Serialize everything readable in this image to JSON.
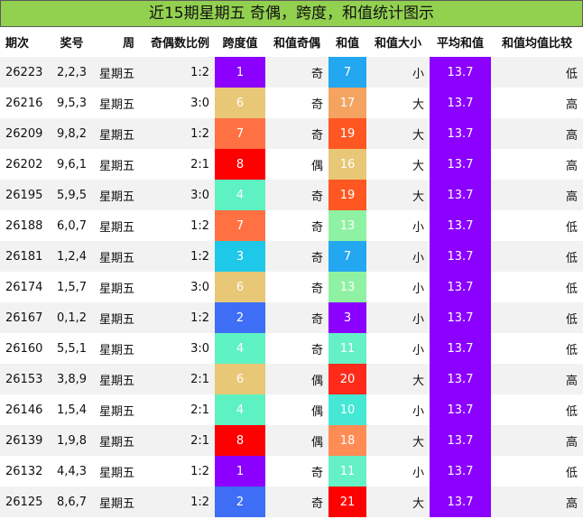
{
  "title": "近15期星期五 奇偶，跨度，和值统计图示",
  "headers": [
    "期次",
    "奖号",
    "周",
    "奇偶数比例",
    "跨度值",
    "和值奇偶",
    "和值",
    "和值大小",
    "平均和值",
    "和值均值比较"
  ],
  "rows": [
    {
      "issue": "26223",
      "nums": "2,2,3",
      "week": "星期五",
      "ratio": "1:2",
      "span": "1",
      "span_color": "#8b00ff",
      "parity": "奇",
      "sum": "7",
      "sum_color": "#22a7f0",
      "size": "小",
      "avg": "13.7",
      "cmp": "低"
    },
    {
      "issue": "26216",
      "nums": "9,5,3",
      "week": "星期五",
      "ratio": "3:0",
      "span": "6",
      "span_color": "#e8c777",
      "parity": "奇",
      "sum": "17",
      "sum_color": "#f4a460",
      "size": "大",
      "avg": "13.7",
      "cmp": "高"
    },
    {
      "issue": "26209",
      "nums": "9,8,2",
      "week": "星期五",
      "ratio": "1:2",
      "span": "7",
      "span_color": "#ff7043",
      "parity": "奇",
      "sum": "19",
      "sum_color": "#ff5722",
      "size": "大",
      "avg": "13.7",
      "cmp": "高"
    },
    {
      "issue": "26202",
      "nums": "9,6,1",
      "week": "星期五",
      "ratio": "2:1",
      "span": "8",
      "span_color": "#ff0000",
      "parity": "偶",
      "sum": "16",
      "sum_color": "#e8c777",
      "size": "大",
      "avg": "13.7",
      "cmp": "高"
    },
    {
      "issue": "26195",
      "nums": "5,9,5",
      "week": "星期五",
      "ratio": "3:0",
      "span": "4",
      "span_color": "#5ef2c2",
      "parity": "奇",
      "sum": "19",
      "sum_color": "#ff5722",
      "size": "大",
      "avg": "13.7",
      "cmp": "高"
    },
    {
      "issue": "26188",
      "nums": "6,0,7",
      "week": "星期五",
      "ratio": "1:2",
      "span": "7",
      "span_color": "#ff7043",
      "parity": "奇",
      "sum": "13",
      "sum_color": "#8ff2a2",
      "size": "小",
      "avg": "13.7",
      "cmp": "低"
    },
    {
      "issue": "26181",
      "nums": "1,2,4",
      "week": "星期五",
      "ratio": "1:2",
      "span": "3",
      "span_color": "#1ec8e8",
      "parity": "奇",
      "sum": "7",
      "sum_color": "#22a7f0",
      "size": "小",
      "avg": "13.7",
      "cmp": "低"
    },
    {
      "issue": "26174",
      "nums": "1,5,7",
      "week": "星期五",
      "ratio": "3:0",
      "span": "6",
      "span_color": "#e8c777",
      "parity": "奇",
      "sum": "13",
      "sum_color": "#8ff2a2",
      "size": "小",
      "avg": "13.7",
      "cmp": "低"
    },
    {
      "issue": "26167",
      "nums": "0,1,2",
      "week": "星期五",
      "ratio": "1:2",
      "span": "2",
      "span_color": "#3d6ef5",
      "parity": "奇",
      "sum": "3",
      "sum_color": "#8b00ff",
      "size": "小",
      "avg": "13.7",
      "cmp": "低"
    },
    {
      "issue": "26160",
      "nums": "5,5,1",
      "week": "星期五",
      "ratio": "3:0",
      "span": "4",
      "span_color": "#5ef2c2",
      "parity": "奇",
      "sum": "11",
      "sum_color": "#66f0c6",
      "size": "小",
      "avg": "13.7",
      "cmp": "低"
    },
    {
      "issue": "26153",
      "nums": "3,8,9",
      "week": "星期五",
      "ratio": "2:1",
      "span": "6",
      "span_color": "#e8c777",
      "parity": "偶",
      "sum": "20",
      "sum_color": "#ff2a1a",
      "size": "大",
      "avg": "13.7",
      "cmp": "高"
    },
    {
      "issue": "26146",
      "nums": "1,5,4",
      "week": "星期五",
      "ratio": "2:1",
      "span": "4",
      "span_color": "#5ef2c2",
      "parity": "偶",
      "sum": "10",
      "sum_color": "#44e8d4",
      "size": "小",
      "avg": "13.7",
      "cmp": "低"
    },
    {
      "issue": "26139",
      "nums": "1,9,8",
      "week": "星期五",
      "ratio": "2:1",
      "span": "8",
      "span_color": "#ff0000",
      "parity": "偶",
      "sum": "18",
      "sum_color": "#ff8c55",
      "size": "大",
      "avg": "13.7",
      "cmp": "高"
    },
    {
      "issue": "26132",
      "nums": "4,4,3",
      "week": "星期五",
      "ratio": "1:2",
      "span": "1",
      "span_color": "#8b00ff",
      "parity": "奇",
      "sum": "11",
      "sum_color": "#66f0c6",
      "size": "小",
      "avg": "13.7",
      "cmp": "低"
    },
    {
      "issue": "26125",
      "nums": "8,6,7",
      "week": "星期五",
      "ratio": "1:2",
      "span": "2",
      "span_color": "#3d6ef5",
      "parity": "奇",
      "sum": "21",
      "sum_color": "#ff0000",
      "size": "大",
      "avg": "13.7",
      "cmp": "高"
    }
  ]
}
